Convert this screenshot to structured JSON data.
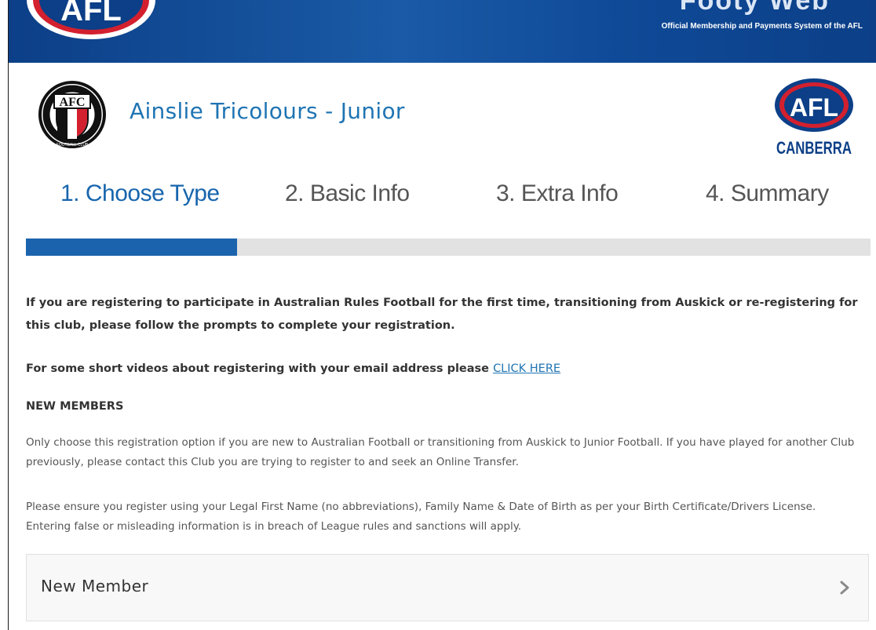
{
  "header": {
    "logo_text": "AFL",
    "wordmark": "Footy Web",
    "subtitle": "Official Membership and Payments System of the AFL"
  },
  "club": {
    "crest_text": "AFC",
    "crest_ring_text": "FOOTBALL CLUB",
    "name": "Ainslie Tricolours - Junior",
    "league_logo_text": "AFL",
    "league_region": "CANBERRA"
  },
  "steps": [
    {
      "label": "1. Choose Type",
      "active": true
    },
    {
      "label": "2. Basic Info",
      "active": false
    },
    {
      "label": "3. Extra Info",
      "active": false
    },
    {
      "label": "4. Summary",
      "active": false
    }
  ],
  "progress": {
    "fraction": 0.25,
    "color": "#1b63ad"
  },
  "content": {
    "intro": "If you are registering to participate in Australian Rules Football for the first time, transitioning from Auskick or re-registering for this club, please follow the prompts to complete your registration.",
    "videos_prefix": "For some short videos about registering with your email address please ",
    "videos_link": "CLICK HERE",
    "new_members_heading": "NEW MEMBERS",
    "para1": "Only choose this registration option if you are new to Australian Football or transitioning from Auskick to Junior Football. If you have played for another Club previously, please contact this Club you are trying to register to and seek an Online Transfer.",
    "para2": "Please ensure you register using your Legal First Name (no abbreviations), Family Name & Date of Birth as per your Birth Certificate/Drivers License. Entering false or misleading information is in breach of League rules and sanctions will apply."
  },
  "option": {
    "label": "New Member",
    "icon": "chevron-right-icon"
  },
  "colors": {
    "brand_blue": "#1f74b3",
    "header_blue": "#0c3f87",
    "accent_red": "#d3202f"
  }
}
